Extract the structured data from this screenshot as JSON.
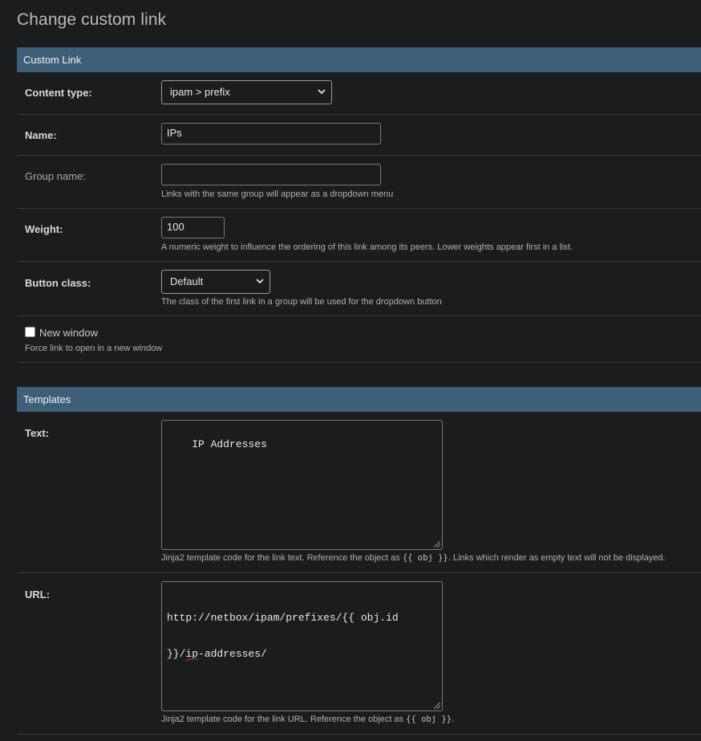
{
  "page": {
    "title": "Change custom link"
  },
  "custom_link_section": {
    "header": "Custom Link"
  },
  "content_type": {
    "label": "Content type:",
    "value": "ipam > prefix"
  },
  "name": {
    "label": "Name:",
    "value": "IPs"
  },
  "group_name": {
    "label": "Group name:",
    "value": "",
    "help": "Links with the same group will appear as a dropdown menu"
  },
  "weight": {
    "label": "Weight:",
    "value": "100",
    "help": "A numeric weight to influence the ordering of this link among its peers. Lower weights appear first in a list."
  },
  "button_class": {
    "label": "Button class:",
    "value": "Default",
    "help": "The class of the first link in a group will be used for the dropdown button"
  },
  "new_window": {
    "label": "New window",
    "checked": false,
    "help": "Force link to open in a new window"
  },
  "templates_section": {
    "header": "Templates"
  },
  "text": {
    "label": "Text:",
    "value": "IP Addresses",
    "help_before": "Jinja2 template code for the link text. Reference the object as ",
    "help_code": "{{ obj }}",
    "help_after": ". Links which render as empty text will not be displayed."
  },
  "url": {
    "label": "URL:",
    "value_line1": "http://netbox/ipam/prefixes/{{ obj.id",
    "value_line2_prefix": "}}/",
    "value_line2_spell": "ip",
    "value_line2_suffix": "-addresses/",
    "help_before": "Jinja2 template code for the link URL. Reference the object as ",
    "help_code": "{{ obj }}",
    "help_after": "."
  }
}
